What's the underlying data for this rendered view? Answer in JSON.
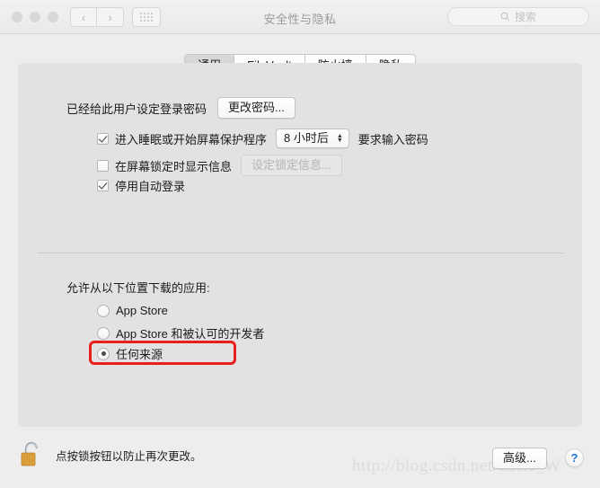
{
  "window": {
    "title": "安全性与隐私",
    "search_placeholder": "搜索",
    "nav_back": "‹",
    "nav_forward": "›"
  },
  "tabs": [
    {
      "label": "通用",
      "active": true
    },
    {
      "label": "FileVault",
      "active": false
    },
    {
      "label": "防火墙",
      "active": false
    },
    {
      "label": "隐私",
      "active": false
    }
  ],
  "general": {
    "password_status": "已经给此用户设定登录密码",
    "change_password_button": "更改密码...",
    "require_password_prefix": "进入睡眠或开始屏幕保护程序",
    "require_password_delay": "8 小时后",
    "require_password_suffix": "要求输入密码",
    "show_message_label": "在屏幕锁定时显示信息",
    "set_lock_message_button": "设定锁定信息...",
    "disable_auto_login_label": "停用自动登录"
  },
  "download_section": {
    "heading": "允许从以下位置下载的应用:",
    "options": [
      {
        "label": "App Store",
        "selected": false
      },
      {
        "label": "App Store 和被认可的开发者",
        "selected": false
      },
      {
        "label": "任何来源",
        "selected": true
      }
    ]
  },
  "footer": {
    "lock_text": "点按锁按钮以防止再次更改。",
    "advanced_button": "高级...",
    "help_button": "?"
  },
  "watermark": "http://blog.csdn.net/CHX_W",
  "colors": {
    "highlight": "#e8201b",
    "help_blue": "#2176d6",
    "lock_gold": "#e0a33c"
  }
}
